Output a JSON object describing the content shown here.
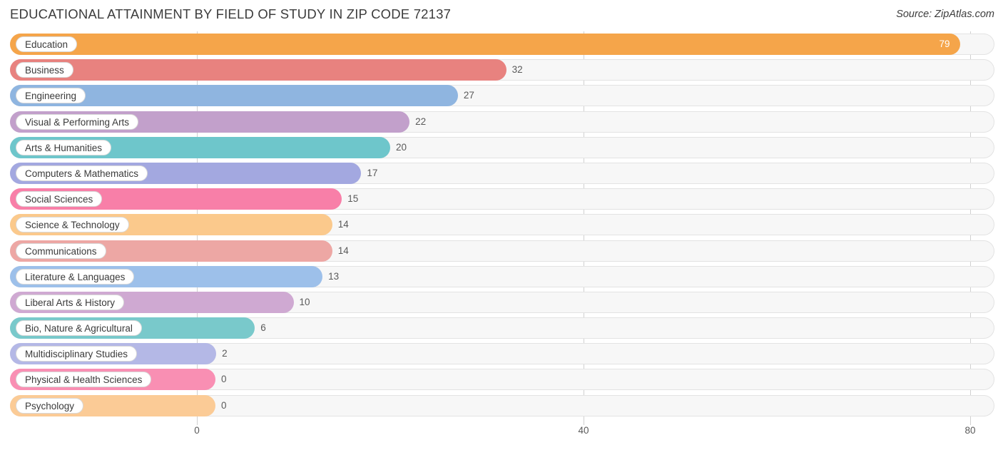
{
  "header": {
    "title": "EDUCATIONAL ATTAINMENT BY FIELD OF STUDY IN ZIP CODE 72137",
    "source": "Source: ZipAtlas.com"
  },
  "chart_data": {
    "type": "bar",
    "orientation": "horizontal",
    "title": "EDUCATIONAL ATTAINMENT BY FIELD OF STUDY IN ZIP CODE 72137",
    "xlabel": "",
    "ylabel": "",
    "xlim": [
      0,
      80
    ],
    "ticks": [
      0,
      40,
      80
    ],
    "tick_labels": [
      "0",
      "40",
      "80"
    ],
    "grid": true,
    "legend": "none",
    "categories": [
      "Education",
      "Business",
      "Engineering",
      "Visual & Performing Arts",
      "Arts & Humanities",
      "Computers & Mathematics",
      "Social Sciences",
      "Science & Technology",
      "Communications",
      "Literature & Languages",
      "Liberal Arts & History",
      "Bio, Nature & Agricultural",
      "Multidisciplinary Studies",
      "Physical & Health Sciences",
      "Psychology"
    ],
    "values": [
      79,
      32,
      27,
      22,
      20,
      17,
      15,
      14,
      14,
      13,
      10,
      6,
      2,
      0,
      0
    ],
    "value_labels": [
      "79",
      "32",
      "27",
      "22",
      "20",
      "17",
      "15",
      "14",
      "14",
      "13",
      "10",
      "6",
      "2",
      "0",
      "0"
    ],
    "colors": [
      "#f5a54a",
      "#e8827f",
      "#8fb5e0",
      "#c2a0cb",
      "#6ec6cb",
      "#a3a8e0",
      "#f87fa8",
      "#fbc98c",
      "#eda7a4",
      "#9dc0ea",
      "#cfa9d2",
      "#79c9cb",
      "#b4b8e6",
      "#f98fb3",
      "#fbcb96"
    ]
  }
}
